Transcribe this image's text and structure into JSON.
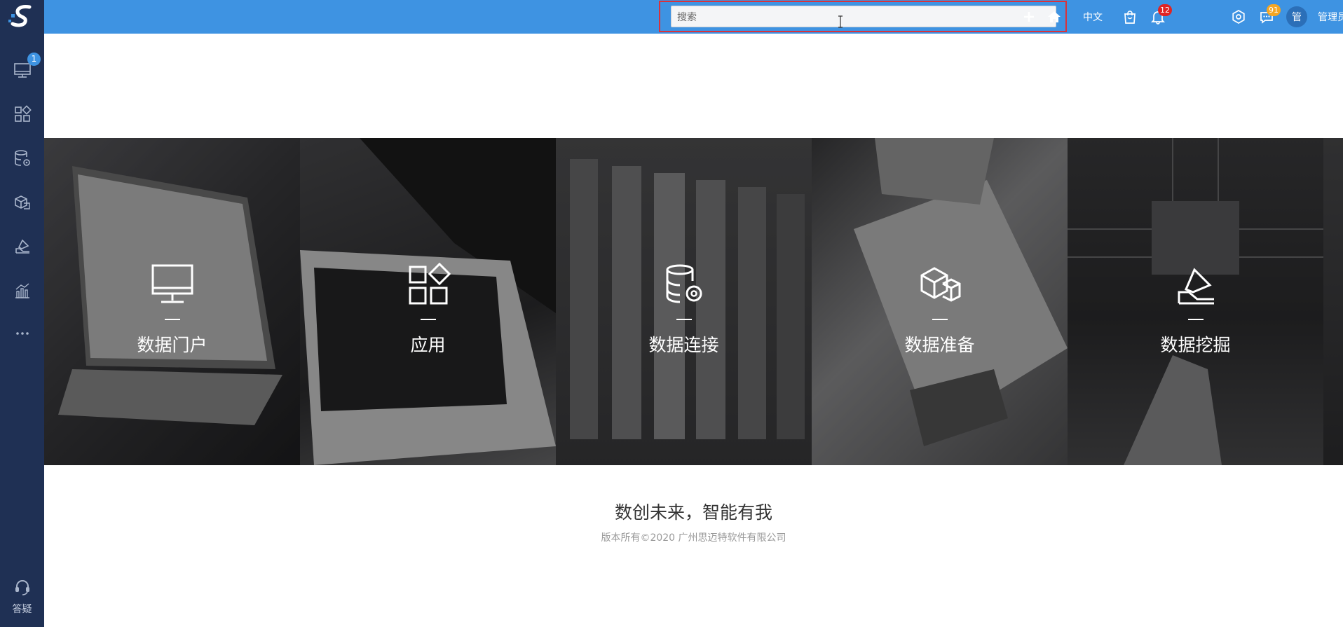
{
  "header": {
    "search_placeholder": "搜索",
    "language": "中文",
    "notifications_count": "12",
    "messages_count": "91",
    "avatar_initial": "管",
    "user_name": "管理员"
  },
  "sidebar": {
    "monitor_badge": "1",
    "help_label": "答疑"
  },
  "tiles": [
    {
      "title": "数据门户",
      "icon": "monitor-icon"
    },
    {
      "title": "应用",
      "icon": "apps-icon"
    },
    {
      "title": "数据连接",
      "icon": "database-gear-icon"
    },
    {
      "title": "数据准备",
      "icon": "cubes-icon"
    },
    {
      "title": "数据挖掘",
      "icon": "mining-icon"
    }
  ],
  "footer": {
    "slogan": "数创未来，智能有我",
    "copyright": "版本所有©2020 广州思迈特软件有限公司"
  },
  "colors": {
    "topbar": "#3e93e2",
    "sidebar": "#1f3054",
    "highlight": "#d9323b",
    "badge_red": "#e02424",
    "badge_orange": "#f5a623"
  }
}
